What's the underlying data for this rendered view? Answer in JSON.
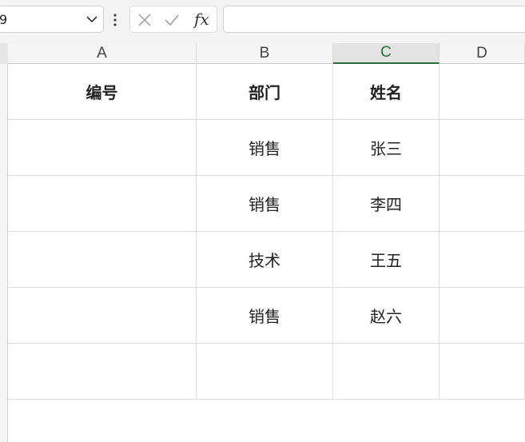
{
  "formula_bar": {
    "name_box_value": "9",
    "formula_value": "",
    "icons": {
      "dropdown": "chevron-down-icon",
      "more": "kebab-icon",
      "cancel": "cancel-x-icon",
      "confirm": "checkmark-icon",
      "function": "fx-icon"
    },
    "fx_label": "fx"
  },
  "sheet": {
    "columns": [
      "A",
      "B",
      "C",
      "D"
    ],
    "selected_column": "C",
    "rows": [
      {
        "A": "编号",
        "B": "部门",
        "C": "姓名",
        "D": ""
      },
      {
        "A": "",
        "B": "销售",
        "C": "张三",
        "D": ""
      },
      {
        "A": "",
        "B": "销售",
        "C": "李四",
        "D": ""
      },
      {
        "A": "",
        "B": "技术",
        "C": "王五",
        "D": ""
      },
      {
        "A": "",
        "B": "销售",
        "C": "赵六",
        "D": ""
      },
      {
        "A": "",
        "B": "",
        "C": "",
        "D": ""
      },
      {
        "A": "",
        "B": "",
        "C": "",
        "D": ""
      }
    ]
  }
}
